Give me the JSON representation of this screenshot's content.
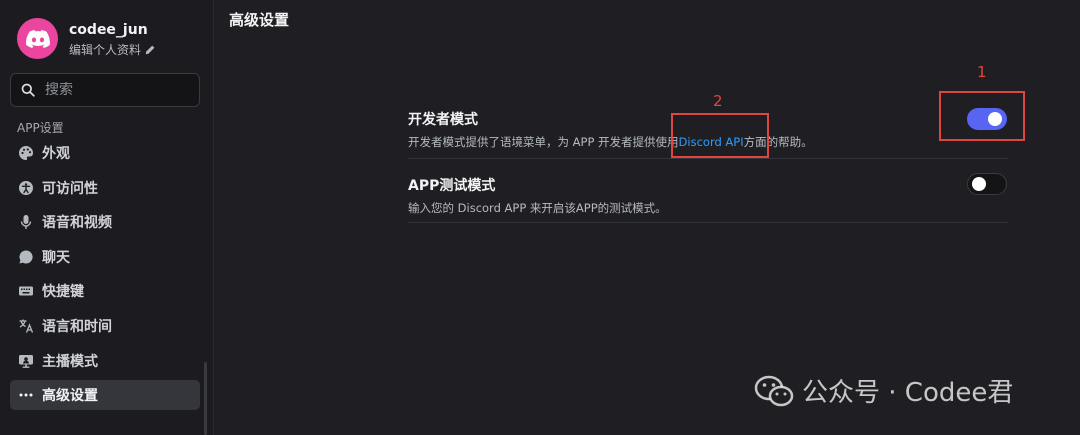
{
  "profile": {
    "username": "codee_jun",
    "edit_label": "编辑个人资料"
  },
  "search": {
    "placeholder": "搜索"
  },
  "sidebar": {
    "section_label": "APP设置",
    "items": [
      {
        "label": "外观",
        "icon": "palette-icon"
      },
      {
        "label": "可访问性",
        "icon": "accessibility-icon"
      },
      {
        "label": "语音和视频",
        "icon": "microphone-icon"
      },
      {
        "label": "聊天",
        "icon": "chat-bubble-icon"
      },
      {
        "label": "快捷键",
        "icon": "keyboard-icon"
      },
      {
        "label": "语言和时间",
        "icon": "translate-icon"
      },
      {
        "label": "主播模式",
        "icon": "stream-icon"
      },
      {
        "label": "高级设置",
        "icon": "more-icon",
        "active": true
      }
    ]
  },
  "main": {
    "title": "高级设置",
    "settings": [
      {
        "title": "开发者模式",
        "desc_before": "开发者模式提供了语境菜单，为 APP 开发者提供使用",
        "desc_link": "Discord API",
        "desc_after": "方面的帮助。",
        "enabled": true
      },
      {
        "title": "APP测试模式",
        "desc": "输入您的 Discord APP 来开启该APP的测试模式。",
        "enabled": false
      }
    ]
  },
  "annotations": {
    "one": "1",
    "two": "2"
  },
  "watermark": {
    "text": "公众号 · Codee君"
  },
  "colors": {
    "accent": "#5865f2",
    "annotation": "#e0463f",
    "link": "#2f9cff",
    "avatar": "#eb459f"
  }
}
